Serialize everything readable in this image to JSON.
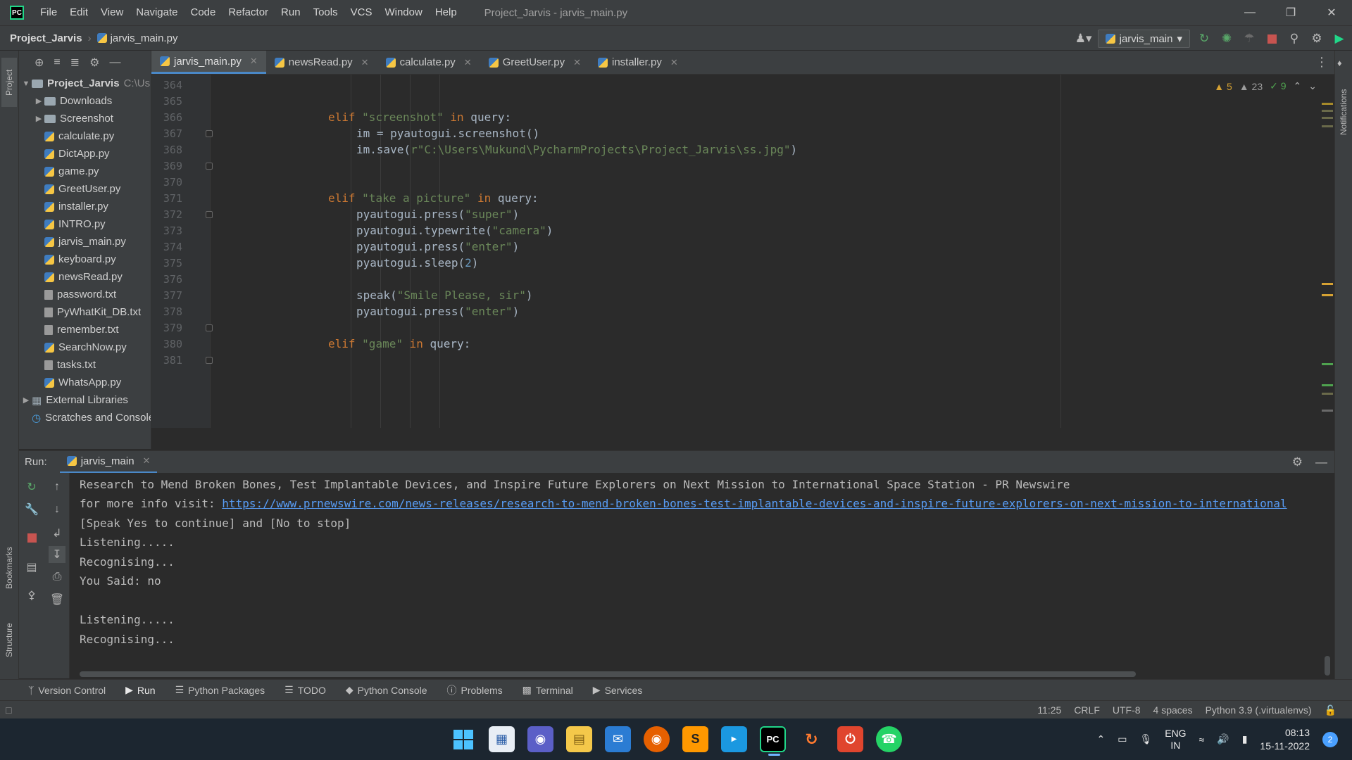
{
  "titlebar": {
    "menu": [
      "File",
      "Edit",
      "View",
      "Navigate",
      "Code",
      "Refactor",
      "Run",
      "Tools",
      "VCS",
      "Window",
      "Help"
    ],
    "window_title": "Project_Jarvis - jarvis_main.py"
  },
  "navbar": {
    "project": "Project_Jarvis",
    "file": "jarvis_main.py",
    "run_config": "jarvis_main"
  },
  "left_strip": {
    "project_tab": "Project",
    "bookmarks_tab": "Bookmarks",
    "structure_tab": "Structure"
  },
  "right_strip": {
    "notifications_tab": "Notifications"
  },
  "project_tree": {
    "root": "Project_Jarvis",
    "root_hint": "C:\\Us",
    "items": [
      {
        "name": "Downloads",
        "type": "folder"
      },
      {
        "name": "Screenshot",
        "type": "folder"
      },
      {
        "name": "calculate.py",
        "type": "py"
      },
      {
        "name": "DictApp.py",
        "type": "py"
      },
      {
        "name": "game.py",
        "type": "py"
      },
      {
        "name": "GreetUser.py",
        "type": "py"
      },
      {
        "name": "installer.py",
        "type": "py"
      },
      {
        "name": "INTRO.py",
        "type": "py"
      },
      {
        "name": "jarvis_main.py",
        "type": "py"
      },
      {
        "name": "keyboard.py",
        "type": "py"
      },
      {
        "name": "newsRead.py",
        "type": "py"
      },
      {
        "name": "password.txt",
        "type": "txt"
      },
      {
        "name": "PyWhatKit_DB.txt",
        "type": "txt"
      },
      {
        "name": "remember.txt",
        "type": "txt"
      },
      {
        "name": "SearchNow.py",
        "type": "py"
      },
      {
        "name": "tasks.txt",
        "type": "txt"
      },
      {
        "name": "WhatsApp.py",
        "type": "py"
      }
    ],
    "external_libraries": "External Libraries",
    "scratches": "Scratches and Consoles"
  },
  "editor_tabs": [
    "jarvis_main.py",
    "newsRead.py",
    "calculate.py",
    "GreetUser.py",
    "installer.py"
  ],
  "inspections": {
    "warnings": "5",
    "weak_warnings": "23",
    "typos": "9"
  },
  "line_numbers": [
    "364",
    "365",
    "366",
    "367",
    "368",
    "369",
    "370",
    "371",
    "372",
    "373",
    "374",
    "375",
    "376",
    "377",
    "378",
    "379",
    "380",
    "381"
  ],
  "code": {
    "l367_kw": "elif",
    "l367_str": "\"screenshot\"",
    "l367_kw2": "in",
    "l367_rest": " query:",
    "l368": "im = pyautogui.screenshot()",
    "l369_a": "im.save(",
    "l369_str": "r\"C:\\Users\\Mukund\\PycharmProjects\\Project_Jarvis\\ss.jpg\"",
    "l369_b": ")",
    "l372_kw": "elif",
    "l372_str": "\"take a picture\"",
    "l372_kw2": "in",
    "l372_rest": " query:",
    "l373_a": "pyautogui.press(",
    "l373_str": "\"super\"",
    "l373_b": ")",
    "l374_a": "pyautogui.typewrite(",
    "l374_str": "\"camera\"",
    "l374_b": ")",
    "l375_a": "pyautogui.press(",
    "l375_str": "\"enter\"",
    "l375_b": ")",
    "l376_a": "pyautogui.sleep(",
    "l376_num": "2",
    "l376_b": ")",
    "l378_a": "speak(",
    "l378_str": "\"Smile Please, sir\"",
    "l378_b": ")",
    "l379_a": "pyautogui.press(",
    "l379_str": "\"enter\"",
    "l379_b": ")",
    "l381_kw": "elif",
    "l381_str": "\"game\"",
    "l381_kw2": "in",
    "l381_rest": " query:"
  },
  "run": {
    "label": "Run:",
    "tab": "jarvis_main",
    "console": [
      "Research to Mend Broken Bones, Test Implantable Devices, and Inspire Future Explorers on Next Mission to International Space Station - PR Newswire",
      "for more info visit: ",
      "[Speak Yes to continue] and [No to stop]",
      "Listening.....",
      "Recognising...",
      "You Said: no",
      "",
      "Listening.....",
      "Recognising..."
    ],
    "link": "https://www.prnewswire.com/news-releases/research-to-mend-broken-bones-test-implantable-devices-and-inspire-future-explorers-on-next-mission-to-international"
  },
  "bottom_tools": [
    "Version Control",
    "Run",
    "Python Packages",
    "TODO",
    "Python Console",
    "Problems",
    "Terminal",
    "Services"
  ],
  "statusbar": {
    "position": "11:25",
    "line_sep": "CRLF",
    "encoding": "UTF-8",
    "indent": "4 spaces",
    "interpreter": "Python 3.9 (.virtualenvs)"
  },
  "taskbar": {
    "lang": "ENG",
    "region": "IN",
    "time": "08:13",
    "date": "15-11-2022",
    "notifications": "2"
  },
  "colors": {
    "accent": "#4a88c7",
    "keyword": "#cc7832",
    "string": "#6a8759",
    "number": "#6897bb",
    "link": "#589df6"
  }
}
